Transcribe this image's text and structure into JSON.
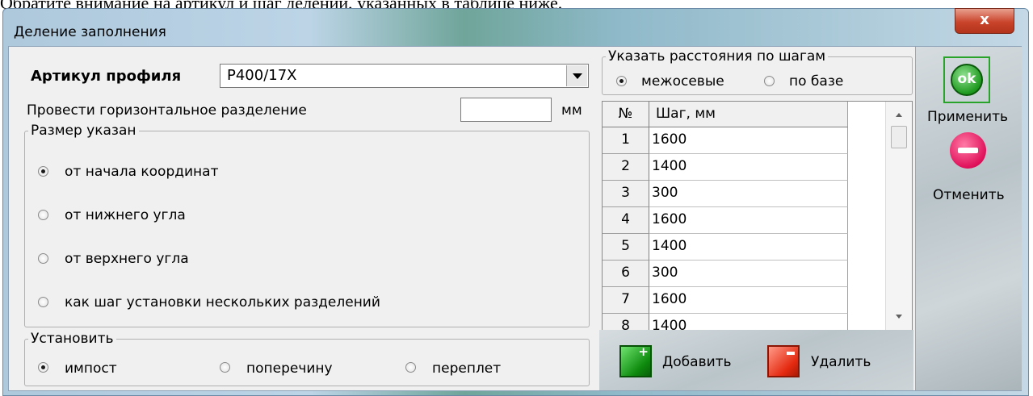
{
  "doc_caption": "Обратите внимание на артикул и шаг делений, указанных в таблице ниже.",
  "window": {
    "title": "Деление заполнения",
    "close_label": "x"
  },
  "profile": {
    "label": "Артикул профиля",
    "value": "P400/17X"
  },
  "horizontal_split": {
    "label": "Провести горизонтальное разделение",
    "value": "",
    "unit": "мм"
  },
  "size_group": {
    "legend": "Размер указан",
    "options": [
      {
        "label": "от начала координат",
        "checked": true
      },
      {
        "label": "от нижнего угла",
        "checked": false
      },
      {
        "label": "от верхнего угла",
        "checked": false
      },
      {
        "label": "как шаг установки нескольких разделений",
        "checked": false
      }
    ]
  },
  "install_group": {
    "legend": "Установить",
    "options": [
      {
        "label": "импост",
        "checked": true
      },
      {
        "label": "поперечину",
        "checked": false
      },
      {
        "label": "переплет",
        "checked": false
      }
    ]
  },
  "steps_group": {
    "legend": "Указать расстояния по шагам",
    "options": [
      {
        "label": "межосевые",
        "checked": true
      },
      {
        "label": "по базе",
        "checked": false
      }
    ]
  },
  "grid": {
    "headers": [
      "№",
      "Шаг, мм"
    ],
    "rows": [
      {
        "n": "1",
        "step": "1600"
      },
      {
        "n": "2",
        "step": "1400"
      },
      {
        "n": "3",
        "step": "300"
      },
      {
        "n": "4",
        "step": "1600"
      },
      {
        "n": "5",
        "step": "1400"
      },
      {
        "n": "6",
        "step": "300"
      },
      {
        "n": "7",
        "step": "1600"
      },
      {
        "n": "8",
        "step": "1400"
      }
    ]
  },
  "actions": {
    "apply": "Применить",
    "cancel": "Отменить",
    "add": "Добавить",
    "delete": "Удалить",
    "ok_glyph": "ok"
  }
}
